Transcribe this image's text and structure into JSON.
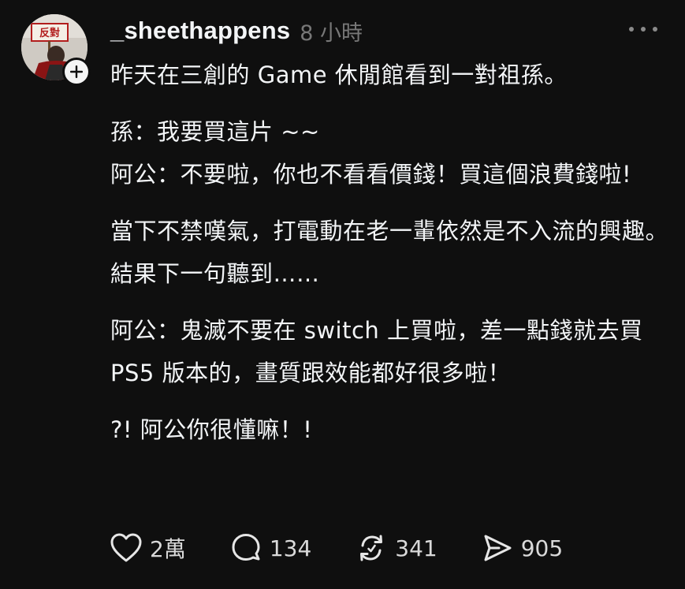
{
  "post": {
    "author": {
      "username": "_sheethappens",
      "timestamp": "8 小時",
      "avatar_sign_text": "反對"
    },
    "body": [
      "昨天在三創的 Game 休閒館看到一對祖孫。",
      "孫：我要買這片 ~~",
      "阿公：不要啦，你也不看看價錢！買這個浪費錢啦!",
      "當下不禁嘆氣，打電動在老一輩依然是不入流的興趣。",
      "結果下一句聽到……",
      "阿公：鬼滅不要在 switch 上買啦，差一點錢就去買 PS5 版本的，畫質跟效能都好很多啦！",
      "?! 阿公你很懂嘛！!"
    ],
    "actions": {
      "like": {
        "icon": "heart-icon",
        "count": "2萬"
      },
      "comment": {
        "icon": "comment-bubble-icon",
        "count": "134"
      },
      "repost": {
        "icon": "repost-icon",
        "count": "341"
      },
      "share": {
        "icon": "send-icon",
        "count": "905"
      }
    }
  },
  "colors": {
    "background": "#0f0f0f",
    "text": "#f3f5f7",
    "muted": "#777777"
  }
}
